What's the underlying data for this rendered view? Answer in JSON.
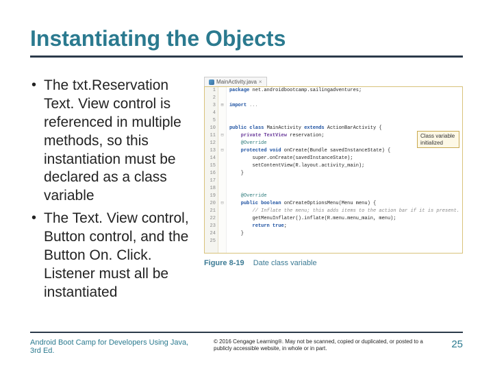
{
  "title": "Instantiating the Objects",
  "bullets": [
    "The txt.Reservation Text. View control is referenced in multiple methods, so this instantiation must be declared as a class variable",
    "The Text. View control, Button control, and the Button On. Click. Listener must all be instantiated"
  ],
  "code_tab": {
    "label": "MainActivity.java",
    "close": "×"
  },
  "gutter_lines": [
    "1",
    "2",
    "3",
    "4",
    "5",
    "10",
    "11",
    "12",
    "13",
    "14",
    "15",
    "16",
    "17",
    "18",
    "19",
    "20",
    "21",
    "22",
    "23",
    "24",
    "25"
  ],
  "marks": [
    "",
    "",
    "⊞",
    "",
    "",
    "",
    "⊟",
    "",
    "⊟",
    "",
    "",
    "",
    "",
    "",
    "",
    "⊟",
    "",
    "",
    "",
    "",
    "",
    ""
  ],
  "code_lines": [
    {
      "html": "<span class='kw-blue'>package</span> <span class='txt-black'>net.androidbootcamp.sailingadventures;</span>"
    },
    {
      "html": ""
    },
    {
      "html": "<span class='kw-blue'>import</span> <span class='txt-grey'>...</span>"
    },
    {
      "html": ""
    },
    {
      "html": ""
    },
    {
      "html": "<span class='kw-blue'>public class</span> <span class='txt-black'>MainActivity</span> <span class='kw-blue'>extends</span> <span class='txt-black'>ActionBarActivity {</span>"
    },
    {
      "html": "    <span class='kw-purple'>private TextView</span> <span class='txt-black'>reservation;</span>"
    },
    {
      "html": "    <span class='kw-teal'>@Override</span>"
    },
    {
      "html": "    <span class='kw-blue'>protected void</span> <span class='txt-black'>onCreate(Bundle savedInstanceState) {</span>"
    },
    {
      "html": "        <span class='txt-black'>super.onCreate(savedInstanceState);</span>"
    },
    {
      "html": "        <span class='txt-black'>setContentView(R.layout.activity_main);</span>"
    },
    {
      "html": "    <span class='txt-black'>}</span>"
    },
    {
      "html": ""
    },
    {
      "html": ""
    },
    {
      "html": "    <span class='kw-teal'>@Override</span>"
    },
    {
      "html": "    <span class='kw-blue'>public boolean</span> <span class='txt-black'>onCreateOptionsMenu(Menu menu) {</span>"
    },
    {
      "html": "        <span class='txt-grey'>// Inflate the menu; this adds items to the action bar if it is present.</span>"
    },
    {
      "html": "        <span class='txt-black'>getMenuInflater().inflate(R.menu.menu_main, menu);</span>"
    },
    {
      "html": "        <span class='kw-blue'>return true</span><span class='txt-black'>;</span>"
    },
    {
      "html": "    <span class='txt-black'>}</span>"
    },
    {
      "html": ""
    }
  ],
  "callout": "Class variable initialized",
  "figure": {
    "num": "Figure 8-19",
    "caption": "Date class variable"
  },
  "footer": {
    "book": "Android Boot Camp for Developers Using Java, 3rd Ed.",
    "copyright": "© 2016 Cengage Learning®. May not be scanned, copied or duplicated, or posted to a publicly accessible website, in whole or in part.",
    "page": "25"
  }
}
